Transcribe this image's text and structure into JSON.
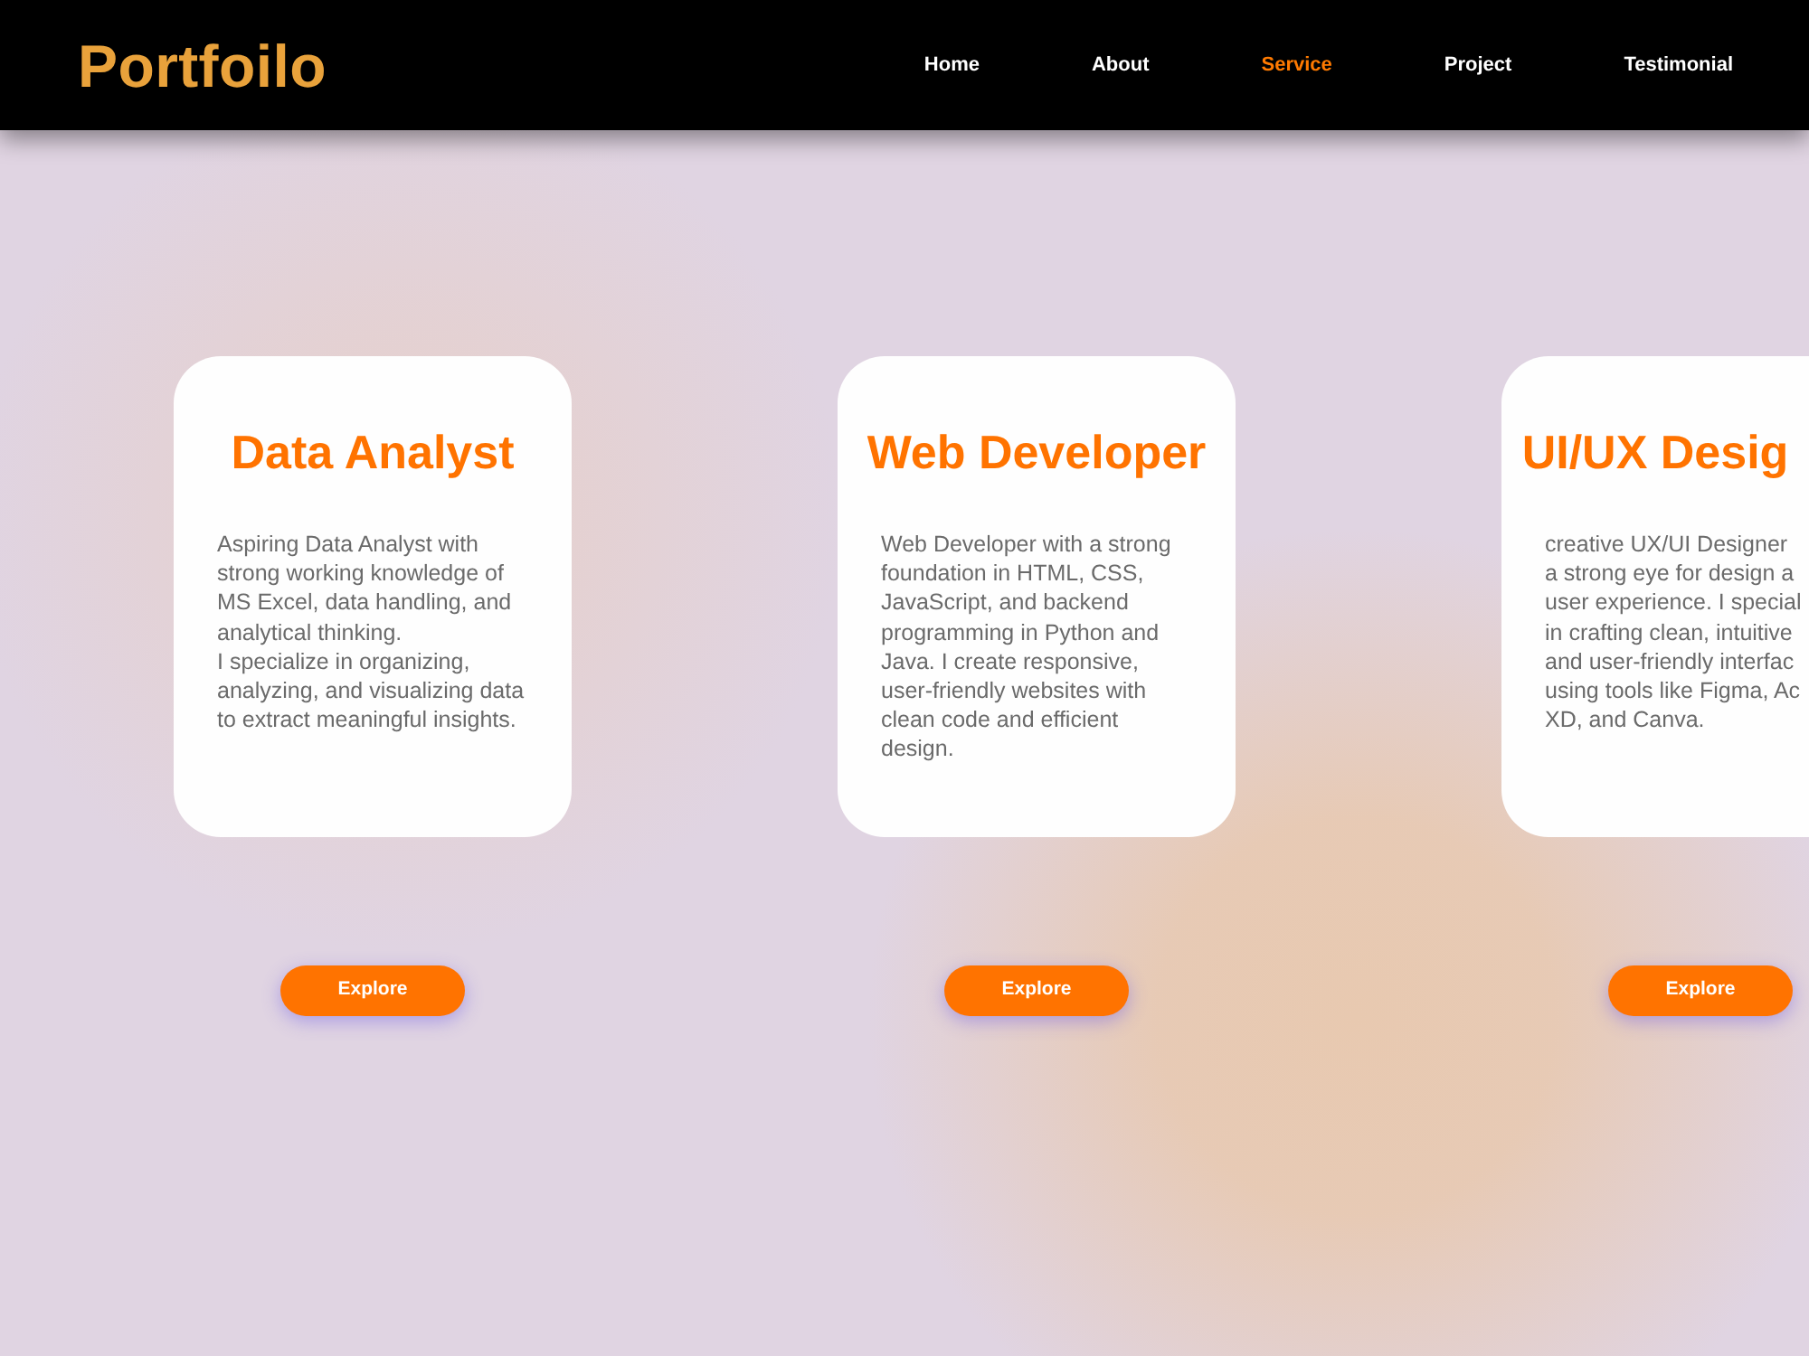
{
  "logo": "Portfoilo",
  "nav": [
    {
      "label": "Home",
      "selected": false
    },
    {
      "label": "About",
      "selected": false
    },
    {
      "label": "Service",
      "selected": true
    },
    {
      "label": "Project",
      "selected": false
    },
    {
      "label": "Testimonial",
      "selected": false
    }
  ],
  "cards": [
    {
      "title": "Data Analyst",
      "description": "Aspiring Data Analyst with strong working knowledge of MS Excel, data handling, and analytical thinking.\nI specialize in organizing, analyzing, and visualizing data to extract meaningful insights.",
      "button": "Explore"
    },
    {
      "title": "Web Developer",
      "description": "Web Developer with a strong foundation in HTML, CSS, JavaScript, and backend programming in Python and Java. I create responsive, user-friendly websites with clean code and efficient design.",
      "button": "Explore"
    },
    {
      "title": "UI/UX Desig",
      "description": "creative UX/UI Designer\na strong eye for design a\nuser experience. I special\nin crafting clean, intuitive\nand user-friendly interfac\nusing tools like Figma, Ac\nXD, and Canva.",
      "button": "Explore"
    }
  ]
}
